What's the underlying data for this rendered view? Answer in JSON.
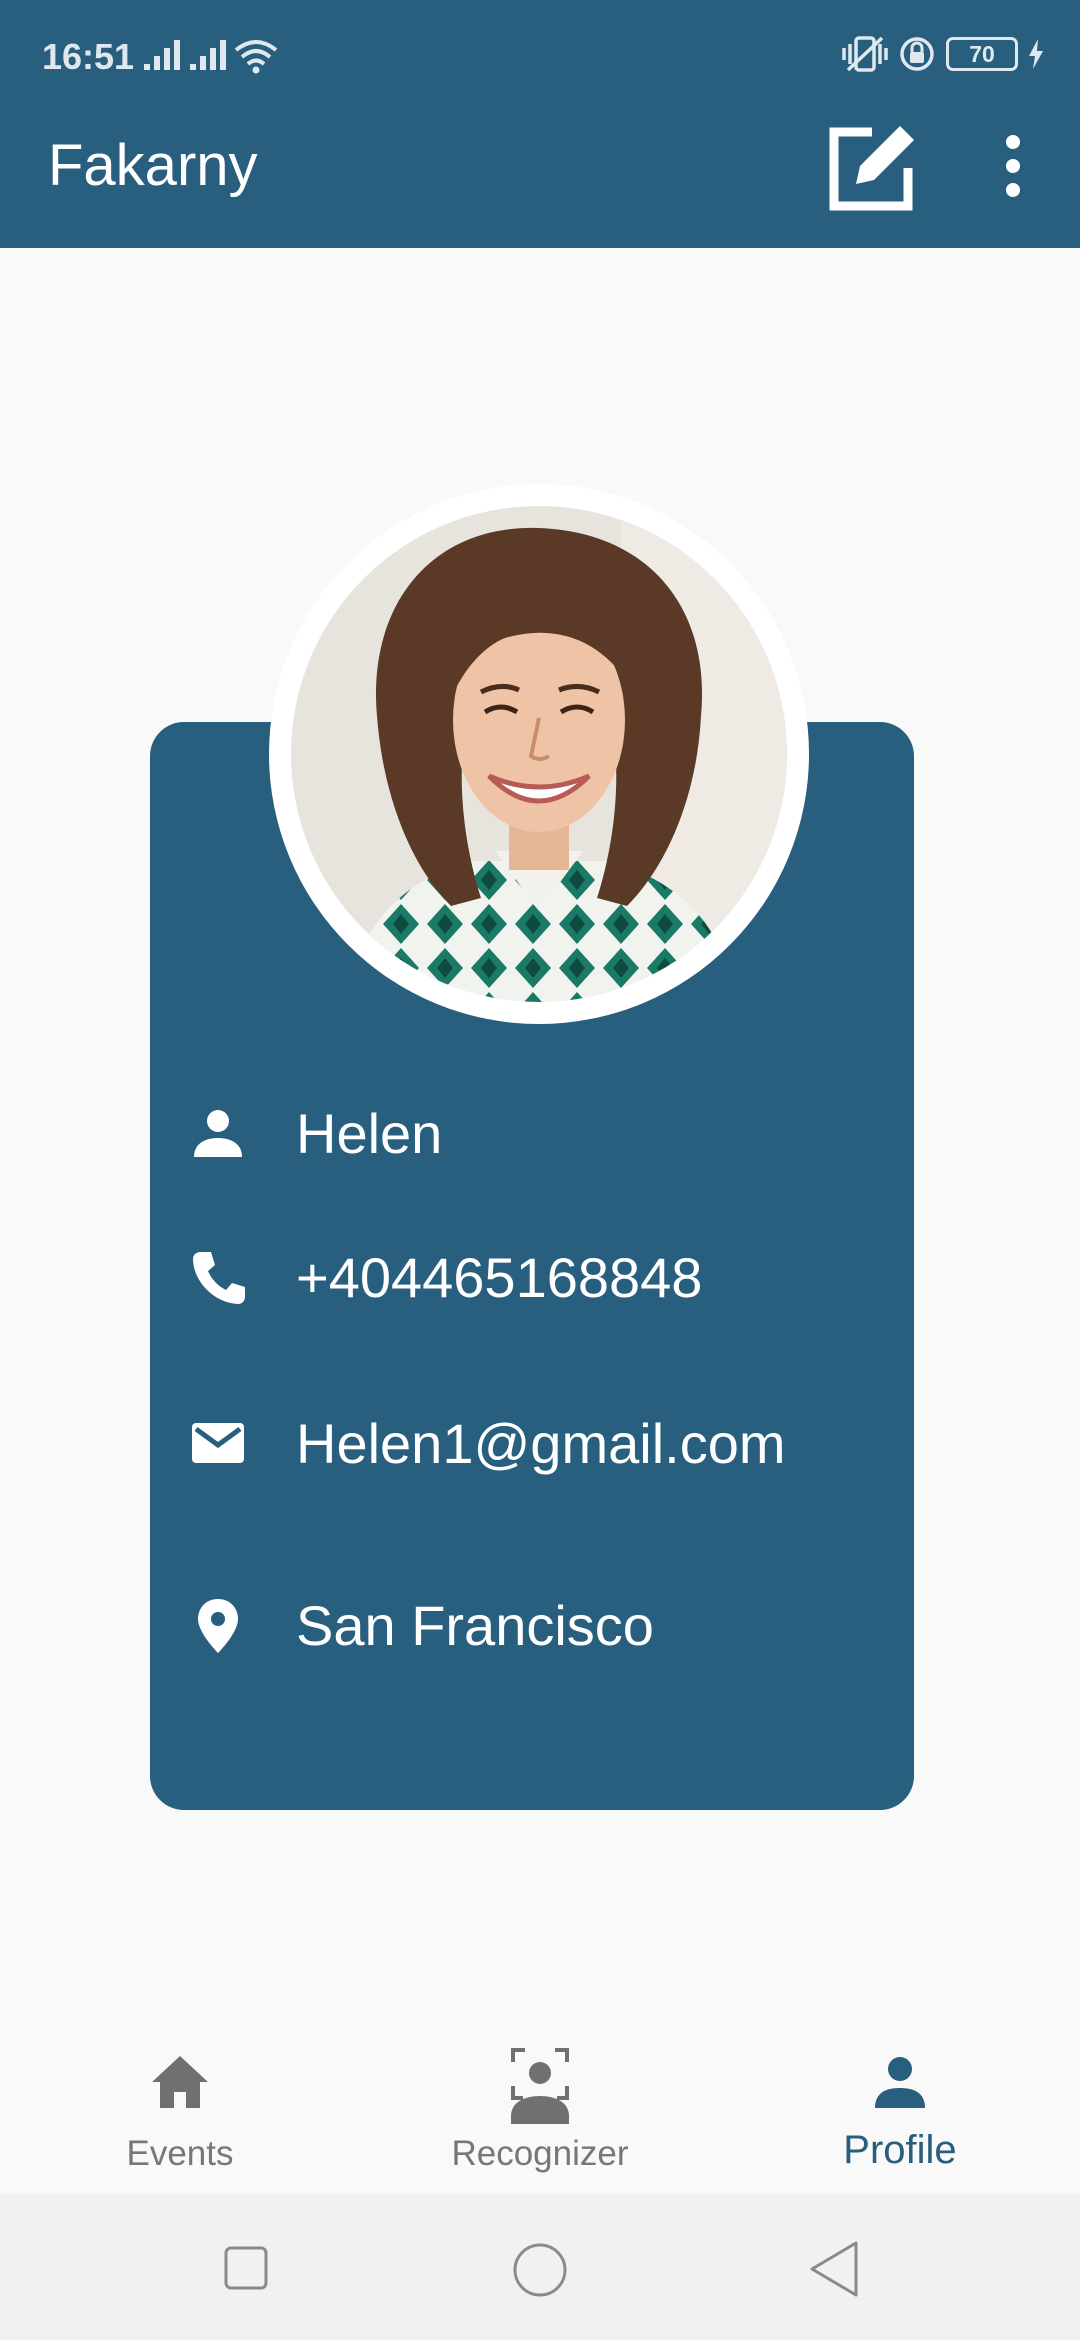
{
  "status_bar": {
    "time": "16:51",
    "battery_level": "70"
  },
  "app_bar": {
    "title": "Fakarny",
    "edit_icon": "edit-square-icon",
    "more_icon": "more-vertical-icon"
  },
  "profile": {
    "name": "Helen",
    "phone": "+404465168848",
    "email": "Helen1@gmail.com",
    "location": "San Francisco"
  },
  "bottom_nav": {
    "items": [
      {
        "label": "Events",
        "icon": "home-icon",
        "active": false
      },
      {
        "label": "Recognizer",
        "icon": "face-scan-icon",
        "active": false
      },
      {
        "label": "Profile",
        "icon": "person-icon",
        "active": true
      }
    ]
  },
  "colors": {
    "primary": "#285f7f",
    "background": "#f9f9f9",
    "inactive_nav": "#777777"
  }
}
